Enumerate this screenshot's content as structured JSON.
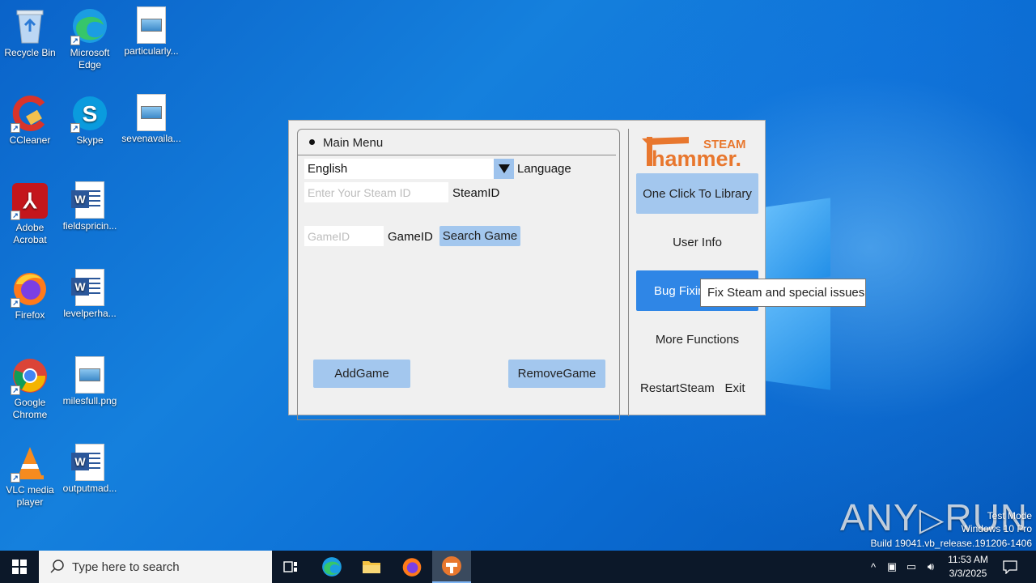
{
  "desktop": {
    "icons": [
      {
        "label": "Recycle Bin",
        "icon": "recycle-bin-icon"
      },
      {
        "label": "Microsoft Edge",
        "icon": "edge-icon"
      },
      {
        "label": "particularly...",
        "icon": "image-file-icon"
      },
      {
        "label": "CCleaner",
        "icon": "ccleaner-icon"
      },
      {
        "label": "Skype",
        "icon": "skype-icon"
      },
      {
        "label": "sevenavaila...",
        "icon": "image-file-icon"
      },
      {
        "label": "Adobe Acrobat",
        "icon": "acrobat-icon"
      },
      {
        "label": "fieldspricin...",
        "icon": "word-doc-icon"
      },
      {
        "label": "Firefox",
        "icon": "firefox-icon"
      },
      {
        "label": "levelperha...",
        "icon": "word-doc-icon"
      },
      {
        "label": "Google Chrome",
        "icon": "chrome-icon"
      },
      {
        "label": "milesfull.png",
        "icon": "image-file-icon"
      },
      {
        "label": "VLC media player",
        "icon": "vlc-icon"
      },
      {
        "label": "outputmad...",
        "icon": "word-doc-icon"
      }
    ]
  },
  "app": {
    "logo_top": "STEAM",
    "logo_bottom": "hammer.",
    "panel_title": "Main Menu",
    "language_value": "English",
    "language_label": "Language",
    "steamid_placeholder": "Enter Your Steam ID",
    "steamid_label": "SteamID",
    "gameid_placeholder": "GameID",
    "gameid_label": "GameID",
    "search_game": "Search Game",
    "add_game": "AddGame",
    "remove_game": "RemoveGame",
    "sidebar": {
      "one_click": "One Click To Library",
      "user_info": "User Info",
      "bug_fixing": "Bug Fixin",
      "more_functions": "More Functions",
      "restart_steam": "RestartSteam",
      "exit": "Exit"
    },
    "tooltip": "Fix Steam and special issues"
  },
  "watermark": {
    "brand_left": "ANY",
    "brand_right": "RUN",
    "line1": "Test Mode",
    "line2": "Windows 10 Pro",
    "line3": "Build 19041.vb_release.191206-1406"
  },
  "taskbar": {
    "search_placeholder": "Type here to search",
    "time": "11:53 AM",
    "date": "3/3/2025"
  },
  "colors": {
    "button_light": "#a3c7ee",
    "button_active": "#2f86e6",
    "logo_orange": "#e8772e",
    "taskbar": "#0c1829"
  }
}
